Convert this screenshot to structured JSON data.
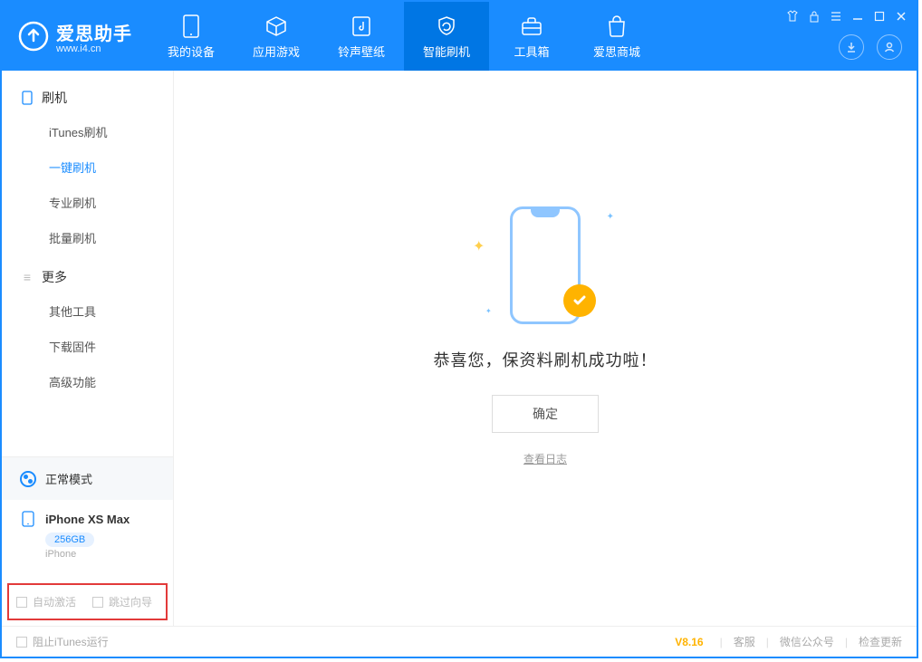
{
  "app": {
    "title": "爱思助手",
    "subtitle": "www.i4.cn"
  },
  "tabs": [
    {
      "label": "我的设备"
    },
    {
      "label": "应用游戏"
    },
    {
      "label": "铃声壁纸"
    },
    {
      "label": "智能刷机"
    },
    {
      "label": "工具箱"
    },
    {
      "label": "爱思商城"
    }
  ],
  "sidebar": {
    "group1": {
      "title": "刷机",
      "items": [
        {
          "label": "iTunes刷机"
        },
        {
          "label": "一键刷机"
        },
        {
          "label": "专业刷机"
        },
        {
          "label": "批量刷机"
        }
      ]
    },
    "group2": {
      "title": "更多",
      "items": [
        {
          "label": "其他工具"
        },
        {
          "label": "下载固件"
        },
        {
          "label": "高级功能"
        }
      ]
    },
    "mode_label": "正常模式",
    "device": {
      "name": "iPhone XS Max",
      "capacity": "256GB",
      "type": "iPhone"
    },
    "checkbox_auto_activate": "自动激活",
    "checkbox_skip_guide": "跳过向导"
  },
  "main": {
    "success_text": "恭喜您，保资料刷机成功啦！",
    "ok_button": "确定",
    "view_log": "查看日志"
  },
  "footer": {
    "block_itunes": "阻止iTunes运行",
    "version": "V8.16",
    "links": [
      {
        "label": "客服"
      },
      {
        "label": "微信公众号"
      },
      {
        "label": "检查更新"
      }
    ]
  }
}
